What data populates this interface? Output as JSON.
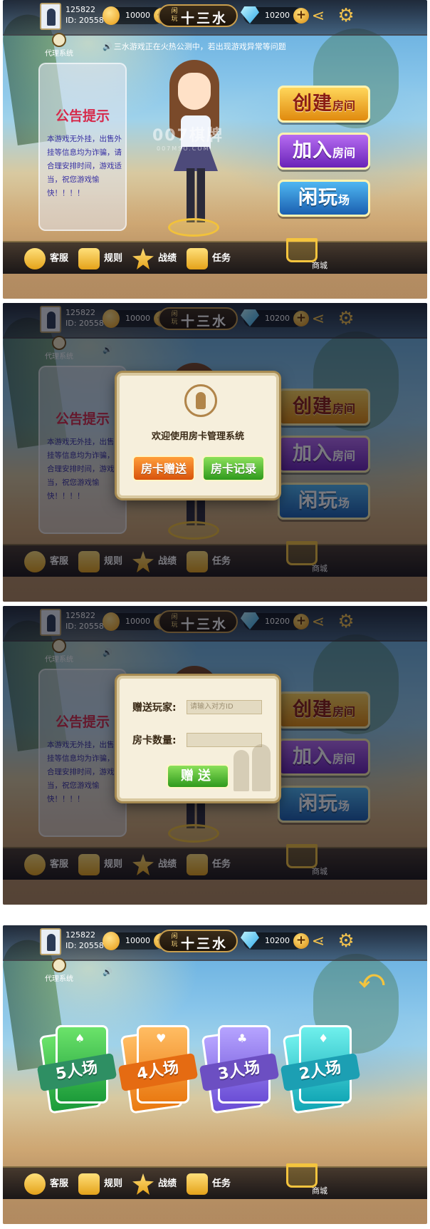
{
  "top": {
    "user_id_number": "125822",
    "user_id_label": "ID: 20558",
    "coins": "10000",
    "title_small": "闲玩",
    "title_big": "十三水",
    "gems": "10200",
    "agent_label": "代理系统"
  },
  "notice": {
    "ticker": "三水游戏正在火热公测中，若出现游戏异常等问题"
  },
  "board": {
    "title": "公告提示",
    "body": "本游戏无外挂，出售外挂等信息均为诈骗，请合理安排时间，游戏适当，祝您游戏愉快！！！！"
  },
  "watermark": {
    "text": "007棋牌",
    "sub": "007MSO.COM"
  },
  "buttons": {
    "create_big": "创建",
    "create_small": "房间",
    "join_big": "加入",
    "join_small": "房间",
    "idle_big": "闲玩",
    "idle_small": "场"
  },
  "bottom": {
    "service": "客服",
    "rules": "规则",
    "records": "战绩",
    "tasks": "任务",
    "shop": "商城"
  },
  "modal_card": {
    "welcome": "欢迎使用房卡管理系统",
    "gift_button": "房卡赠送",
    "log_button": "房卡记录"
  },
  "modal_gift": {
    "player_label": "赠送玩家:",
    "player_placeholder": "请输入对方ID",
    "count_label": "房卡数量:",
    "send_button": "赠送"
  },
  "modes": [
    {
      "label": "5人场",
      "suit": "♠"
    },
    {
      "label": "4人场",
      "suit": "♥"
    },
    {
      "label": "3人场",
      "suit": "♣"
    },
    {
      "label": "2人场",
      "suit": "♦"
    }
  ],
  "icons": {
    "coin": "coin-icon",
    "gem": "diamond-icon",
    "share": "share-icon",
    "settings": "gear-icon",
    "speaker": "speaker-icon",
    "back": "back-arrow-icon",
    "cart": "cart-icon"
  },
  "colors": {
    "gold": "#f4c43e",
    "notice_title": "#d62a4b",
    "notice_text": "#3730a3"
  }
}
